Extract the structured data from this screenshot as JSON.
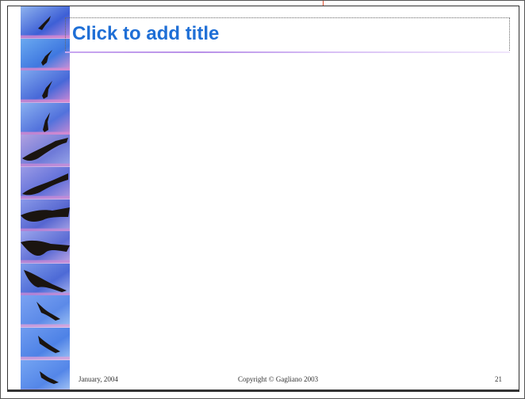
{
  "slide": {
    "title_placeholder": "Click to add title",
    "footer": {
      "date": "January, 2004",
      "copyright": "Copyright © Gagliano 2003",
      "page_number": "21"
    }
  },
  "decoration": {
    "strip_icon": "eagle-photo-strip",
    "tile_count": 12,
    "colors": {
      "title": "#1f6fd6",
      "sky_blue": "#6a8fe8",
      "sky_pink": "#d98ad0",
      "bird": "#1a1410"
    }
  }
}
